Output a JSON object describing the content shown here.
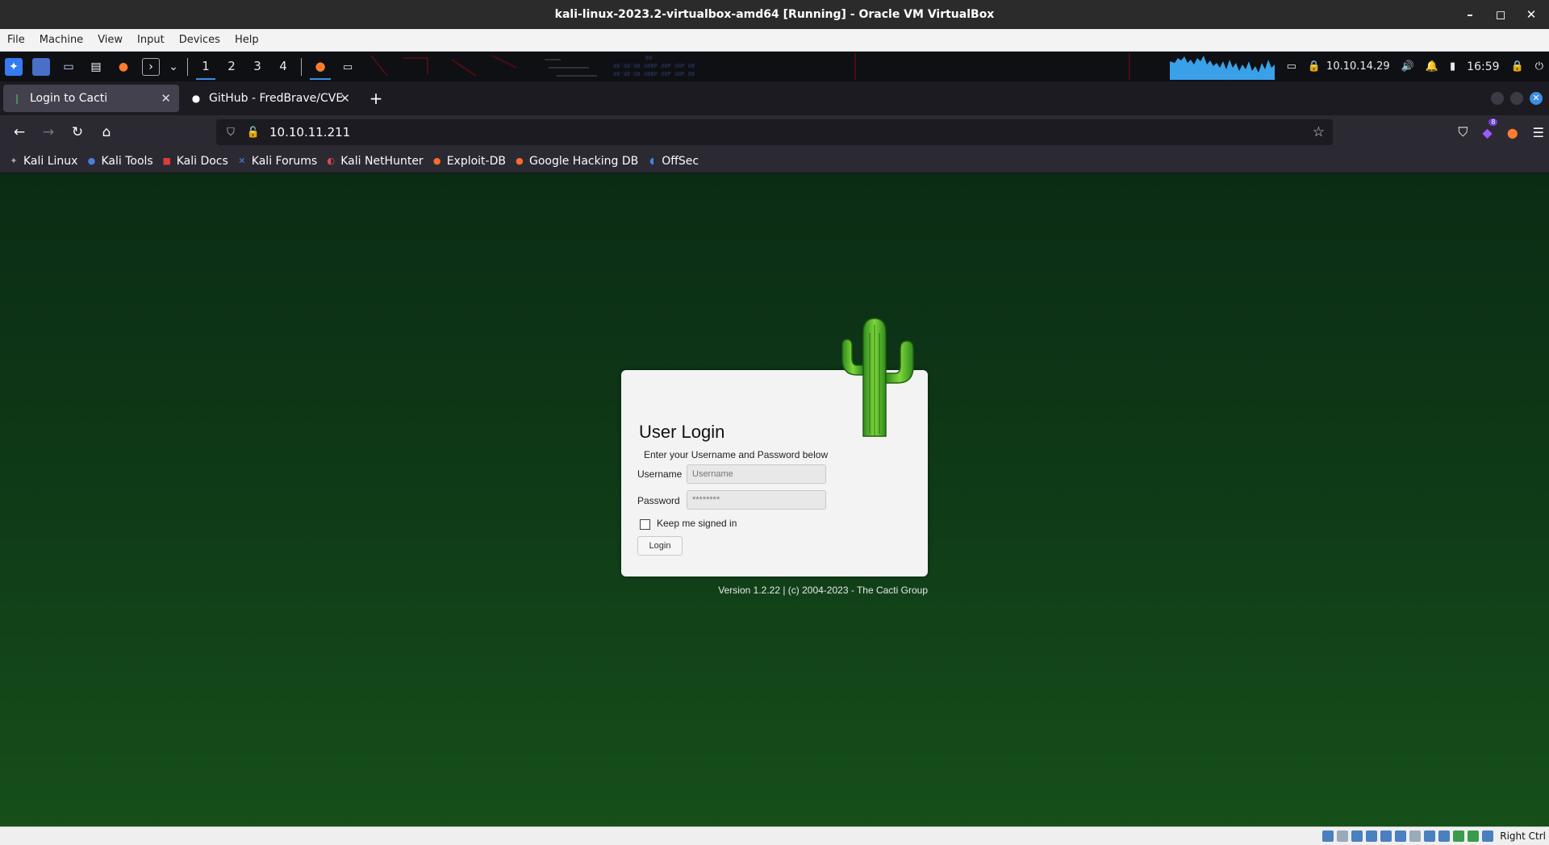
{
  "vbox": {
    "title": "kali-linux-2023.2-virtualbox-amd64 [Running] - Oracle VM VirtualBox",
    "menu": [
      "File",
      "Machine",
      "View",
      "Input",
      "Devices",
      "Help"
    ],
    "host_key": "Right Ctrl"
  },
  "kali_panel": {
    "workspaces": [
      "1",
      "2",
      "3",
      "4"
    ],
    "active_workspace": "1",
    "ip": "10.10.14.29",
    "time": "16:59"
  },
  "firefox": {
    "tabs": [
      {
        "title": "Login to Cacti",
        "active": true
      },
      {
        "title": "GitHub - FredBrave/CVE-",
        "active": false
      }
    ],
    "url": "10.10.11.211",
    "extension_badge": "8",
    "bookmarks": [
      "Kali Linux",
      "Kali Tools",
      "Kali Docs",
      "Kali Forums",
      "Kali NetHunter",
      "Exploit-DB",
      "Google Hacking DB",
      "OffSec"
    ]
  },
  "login": {
    "title": "User Login",
    "subtitle": "Enter your Username and Password below",
    "username_label": "Username",
    "username_placeholder": "Username",
    "password_label": "Password",
    "password_placeholder": "********",
    "remember_label": "Keep me signed in",
    "button": "Login",
    "footer": "Version 1.2.22 | (c) 2004-2023 - The Cacti Group"
  },
  "colors": {
    "page_bg_top": "#0b2c14",
    "page_bg_bottom": "#164f1a",
    "accent": "#3b8fe2"
  }
}
